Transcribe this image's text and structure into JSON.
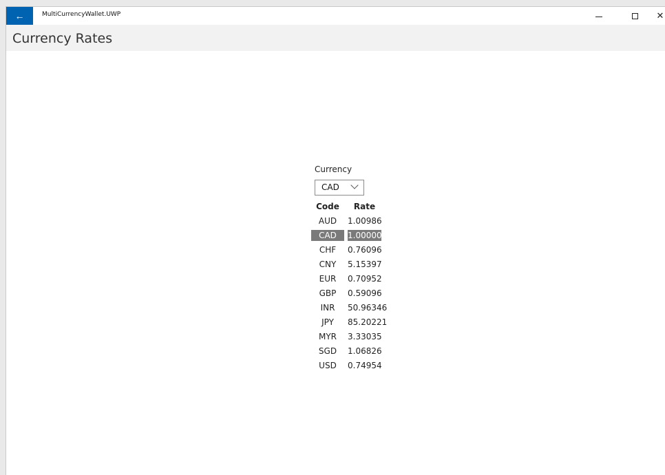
{
  "window": {
    "title": "MultiCurrencyWallet.UWP",
    "back_glyph": "←",
    "minimize_glyph": "",
    "maximize_glyph": "",
    "close_glyph": "✕"
  },
  "page": {
    "title": "Currency Rates"
  },
  "currency_selector": {
    "label": "Currency",
    "selected": "CAD"
  },
  "rates_table": {
    "headers": {
      "code": "Code",
      "rate": "Rate"
    },
    "rows": [
      {
        "code": "AUD",
        "rate": "1.00986"
      },
      {
        "code": "CAD",
        "rate": "1.00000",
        "selected": true
      },
      {
        "code": "CHF",
        "rate": "0.76096"
      },
      {
        "code": "CNY",
        "rate": "5.15397"
      },
      {
        "code": "EUR",
        "rate": "0.70952"
      },
      {
        "code": "GBP",
        "rate": "0.59096"
      },
      {
        "code": "INR",
        "rate": "50.96346"
      },
      {
        "code": "JPY",
        "rate": "85.20221"
      },
      {
        "code": "MYR",
        "rate": "3.33035"
      },
      {
        "code": "SGD",
        "rate": "1.06826"
      },
      {
        "code": "USD",
        "rate": "0.74954"
      }
    ]
  },
  "colors": {
    "accent": "#0063b1",
    "selection": "#7a7a7a",
    "header_bg": "#f2f2f2"
  }
}
